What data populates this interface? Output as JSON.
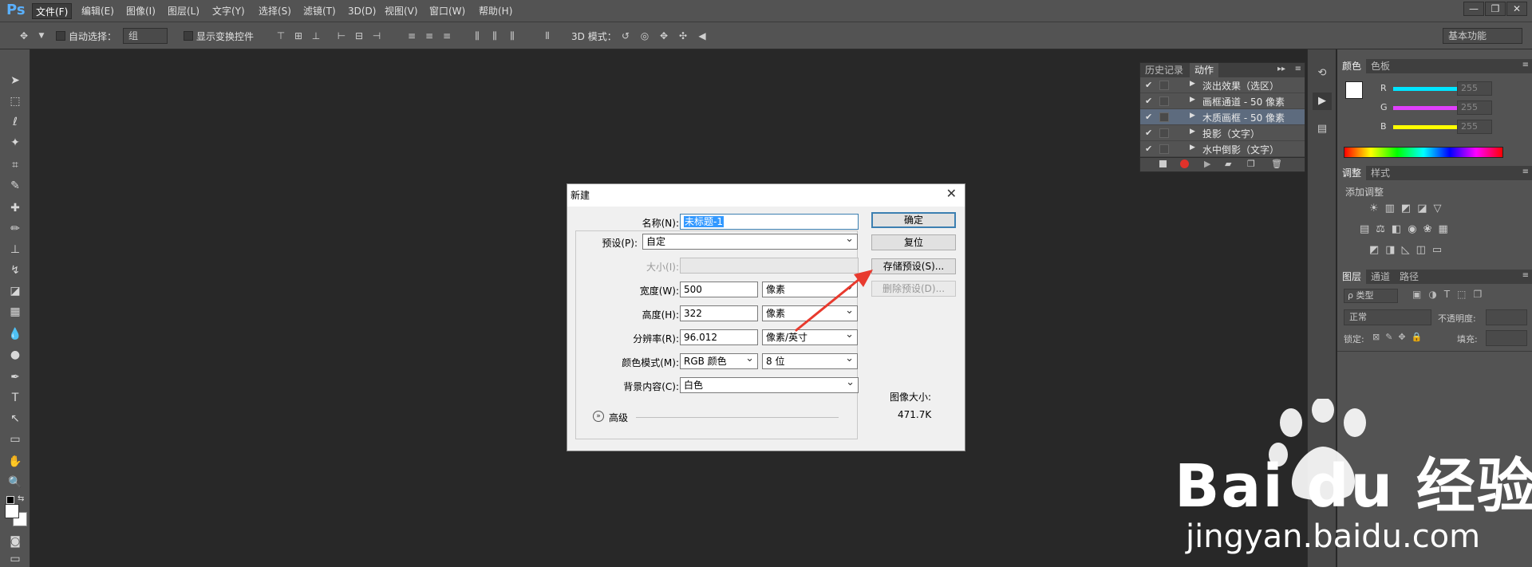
{
  "app": {
    "logo": "Ps"
  },
  "menubar": {
    "items": [
      "文件(F)",
      "编辑(E)",
      "图像(I)",
      "图层(L)",
      "文字(Y)",
      "选择(S)",
      "滤镜(T)",
      "3D(D)",
      "视图(V)",
      "窗口(W)",
      "帮助(H)"
    ],
    "window_buttons": [
      "—",
      "❐",
      "✕"
    ]
  },
  "optionsbar": {
    "auto_select_label": "自动选择：",
    "auto_select_value": "组",
    "show_transform_label": "显示变换控件",
    "mode_3d_label": "3D 模式：",
    "workspace_value": "基本功能"
  },
  "actions_panel": {
    "tabs": [
      "历史记录",
      "动作"
    ],
    "rows": [
      {
        "label": "淡出效果（选区）"
      },
      {
        "label": "画框通道 - 50 像素"
      },
      {
        "label": "木质画框 - 50 像素"
      },
      {
        "label": "投影（文字）"
      },
      {
        "label": "水中倒影（文字）"
      }
    ]
  },
  "color_panel": {
    "tabs": [
      "颜色",
      "色板"
    ],
    "channels": [
      {
        "name": "R",
        "value": "255",
        "color": "#00e5ff"
      },
      {
        "name": "G",
        "value": "255",
        "color": "#e040fb"
      },
      {
        "name": "B",
        "value": "255",
        "color": "#ffff00"
      }
    ]
  },
  "adjust_panel": {
    "tabs": [
      "调整",
      "样式"
    ],
    "heading": "添加调整"
  },
  "layers_panel": {
    "tabs": [
      "图层",
      "通道",
      "路径"
    ],
    "filter_label": "ρ 类型",
    "blend_mode": "正常",
    "opacity_label": "不透明度:",
    "lock_label": "锁定:",
    "fill_label": "填充:"
  },
  "dialog": {
    "title": "新建",
    "name_label": "名称(N):",
    "name_value": "未标题-1",
    "preset_label": "预设(P):",
    "preset_value": "自定",
    "size_label": "大小(I):",
    "width_label": "宽度(W):",
    "width_value": "500",
    "width_unit": "像素",
    "height_label": "高度(H):",
    "height_value": "322",
    "height_unit": "像素",
    "resolution_label": "分辨率(R):",
    "resolution_value": "96.012",
    "resolution_unit": "像素/英寸",
    "color_mode_label": "颜色模式(M):",
    "color_mode_value": "RGB 颜色",
    "bit_depth_value": "8 位",
    "background_label": "背景内容(C):",
    "background_value": "白色",
    "advanced_label": "高级",
    "ok_label": "确定",
    "reset_label": "复位",
    "save_preset_label": "存储预设(S)...",
    "delete_preset_label": "删除预设(D)...",
    "image_size_label": "图像大小:",
    "image_size_value": "471.7K"
  },
  "watermark": {
    "brand": "Bai du 经验",
    "url": "jingyan.baidu.com"
  }
}
